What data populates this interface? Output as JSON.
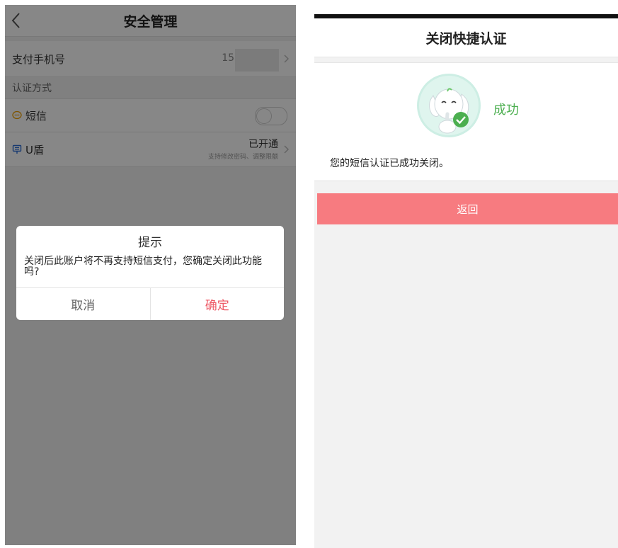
{
  "left": {
    "header": {
      "title": "安全管理"
    },
    "pay_phone": {
      "label": "支付手机号",
      "value": "150"
    },
    "auth_section_label": "认证方式",
    "sms": {
      "label": "短信",
      "enabled": false
    },
    "ukey": {
      "label": "U盾",
      "status": "已开通",
      "description": "支持修改密码、调整限额"
    },
    "dialog": {
      "title": "提示",
      "message": "关闭后此账户将不再支持短信支付，您确定关闭此功能吗?",
      "cancel_label": "取消",
      "confirm_label": "确定"
    }
  },
  "right": {
    "header": {
      "title": "关闭快捷认证"
    },
    "result": {
      "status_text": "成功",
      "message": "您的短信认证已成功关闭。"
    },
    "back_button_label": "返回"
  },
  "colors": {
    "confirm_red": "#ee5a66",
    "success_green": "#4caf50",
    "button_pink": "#f77b80",
    "overlay": "rgba(0,0,0,0.47)"
  },
  "icons": {
    "back": "chevron-left-icon",
    "row_arrow": "chevron-right-icon",
    "sms": "message-icon",
    "ukey": "ukey-icon",
    "mascot": "mascot-success-icon"
  }
}
